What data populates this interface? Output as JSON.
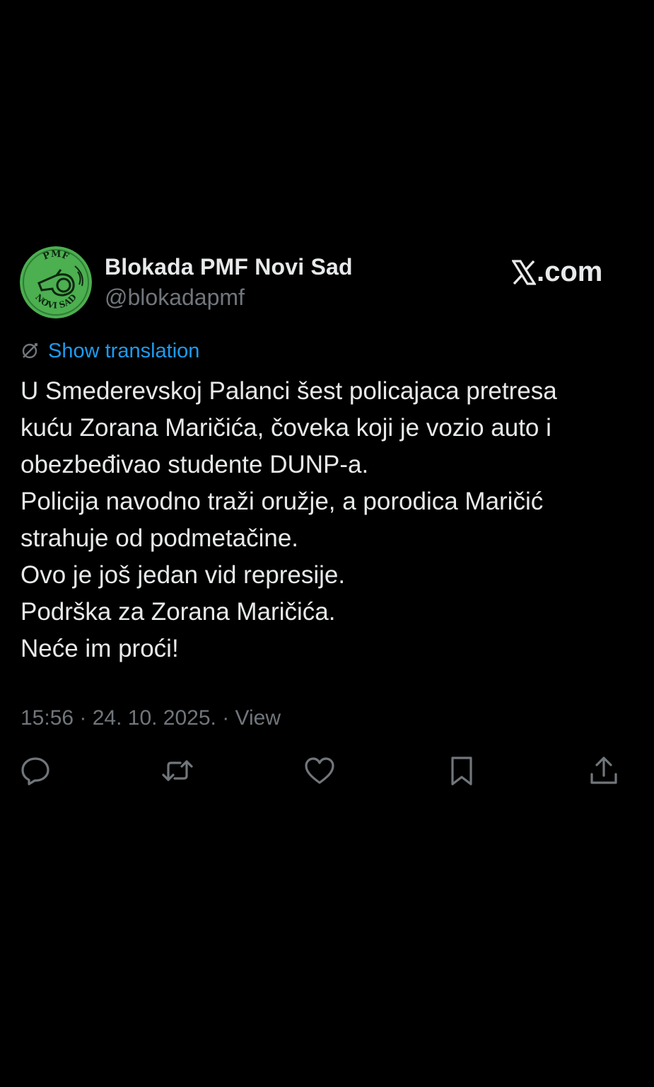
{
  "tweet": {
    "author": {
      "display_name": "Blokada PMF Novi Sad",
      "handle": "@blokadapmf",
      "avatar_text_top": "PMF",
      "avatar_text_bottom": "NOVI SAD",
      "avatar_color": "#4caf50"
    },
    "brand": {
      "label": ".com",
      "icon": "x-logo-icon"
    },
    "translate": {
      "label": "Show translation",
      "icon": "translate-icon",
      "color": "#1d9bf0"
    },
    "body_lines": [
      "U Smederevskoj Palanci  šest policajaca pretresa",
      "kuću Zorana Maričića, čoveka koji je vozio auto i",
      "obezbeđivao studente DUNP-a.",
      "Policija navodno traži oružje, a porodica Maričić",
      "strahuje od podmetačine.",
      "Ovo je još jedan vid represije.",
      "Podrška za Zorana Maričića.",
      "Neće im proći!"
    ],
    "meta": "15:56 · 24. 10. 2025. · View",
    "actions": {
      "reply": "reply-icon",
      "retweet": "retweet-icon",
      "like": "like-icon",
      "bookmark": "bookmark-icon",
      "share": "share-icon"
    }
  },
  "colors": {
    "background": "#000000",
    "text": "#e7e9ea",
    "secondary": "#71767b",
    "accent": "#1d9bf0"
  }
}
